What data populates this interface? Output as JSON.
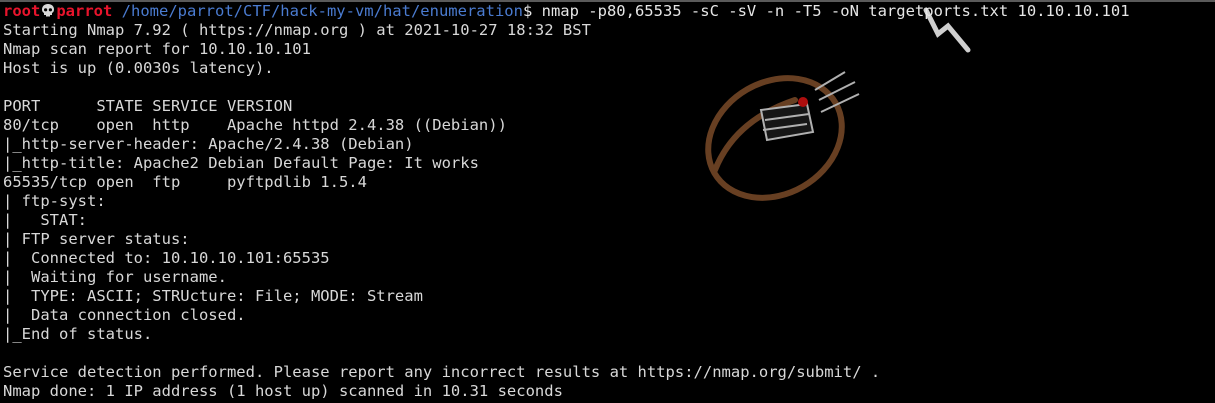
{
  "prompt": {
    "user": "root",
    "host": "parrot",
    "path": "/home/parrot/CTF/hack-my-vm/hat/enumeration",
    "symbol": "$",
    "command": " nmap -p80,65535 -sC -sV -n -T5 -oN targetports.txt 10.10.10.101"
  },
  "output": {
    "start": "Starting Nmap 7.92 ( https://nmap.org ) at 2021-10-27 18:32 BST",
    "report": "Nmap scan report for 10.10.10.101",
    "host_up": "Host is up (0.0030s latency).",
    "header": "PORT      STATE SERVICE VERSION",
    "port80": "80/tcp    open  http    Apache httpd 2.4.38 ((Debian))",
    "http_header": "|_http-server-header: Apache/2.4.38 (Debian)",
    "http_title": "|_http-title: Apache2 Debian Default Page: It works",
    "port65535": "65535/tcp open  ftp     pyftpdlib 1.5.4",
    "ftp_syst": "| ftp-syst: ",
    "stat": "|   STAT: ",
    "ftp_status": "| FTP server status:",
    "connected": "|  Connected to: 10.10.10.101:65535",
    "waiting": "|  Waiting for username.",
    "type": "|  TYPE: ASCII; STRUcture: File; MODE: Stream",
    "data_closed": "|  Data connection closed.",
    "end_status": "|_End of status.",
    "service_detection": "Service detection performed. Please report any incorrect results at https://nmap.org/submit/ .",
    "done": "Nmap done: 1 IP address (1 host up) scanned in 10.31 seconds"
  },
  "colors": {
    "background": "#000000",
    "prompt_user": "#e8142c",
    "prompt_path": "#4a7bd0",
    "text": "#d8d8d8",
    "watermark": "#7a4a28"
  },
  "icons": {
    "skull": "skull-icon",
    "watermark": "hat-logo-watermark"
  }
}
